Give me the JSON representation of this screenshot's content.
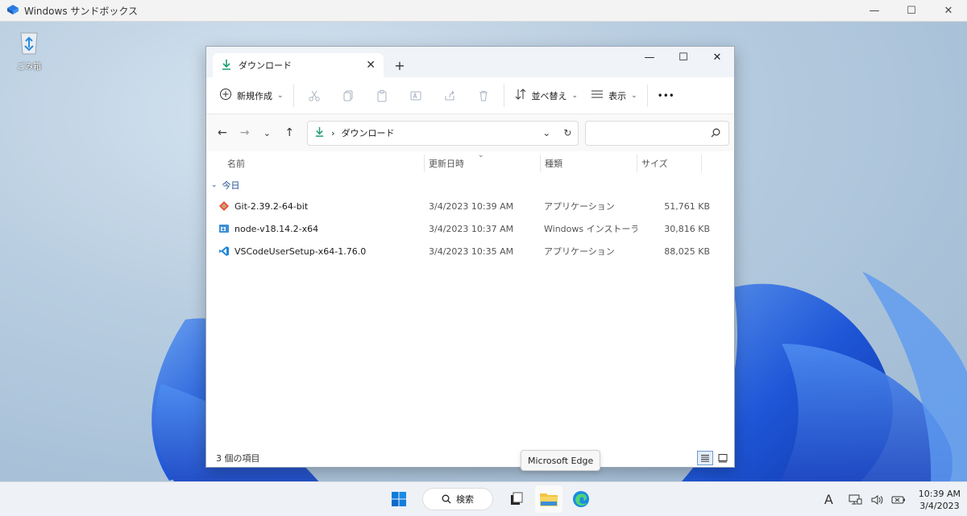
{
  "host": {
    "title": "Windows サンドボックス",
    "icon": "sandbox-icon",
    "minimize": "—",
    "maximize": "☐",
    "close": "✕"
  },
  "desktop": {
    "recycle_bin_label": "ごみ箱"
  },
  "explorer": {
    "tab_title": "ダウンロード",
    "tab_close": "✕",
    "new_tab": "+",
    "window_controls": {
      "minimize": "—",
      "maximize": "☐",
      "close": "✕"
    },
    "commandbar": {
      "new_label": "新規作成",
      "sort_label": "並べ替え",
      "view_label": "表示",
      "more_label": "•••"
    },
    "address": {
      "path_sep": "›",
      "path": "ダウンロード"
    },
    "columns": {
      "name": "名前",
      "modified": "更新日時",
      "type": "種類",
      "size": "サイズ"
    },
    "group_label": "今日",
    "files": [
      {
        "name": "Git-2.39.2-64-bit",
        "date": "3/4/2023 10:39 AM",
        "type": "アプリケーション",
        "size": "51,761 KB",
        "icon": "git-icon"
      },
      {
        "name": "node-v18.14.2-x64",
        "date": "3/4/2023 10:37 AM",
        "type": "Windows インストーラー...",
        "size": "30,816 KB",
        "icon": "msi-installer-icon"
      },
      {
        "name": "VSCodeUserSetup-x64-1.76.0",
        "date": "3/4/2023 10:35 AM",
        "type": "アプリケーション",
        "size": "88,025 KB",
        "icon": "vscode-icon"
      }
    ],
    "status": "3 個の項目"
  },
  "tooltip": "Microsoft Edge",
  "taskbar": {
    "search_label": "検索",
    "ime": "A",
    "time": "10:39 AM",
    "date": "3/4/2023"
  },
  "colors": {
    "accent": "#0067c0",
    "download_green": "#1f9e6e",
    "folder_yellow": "#f4c542"
  }
}
